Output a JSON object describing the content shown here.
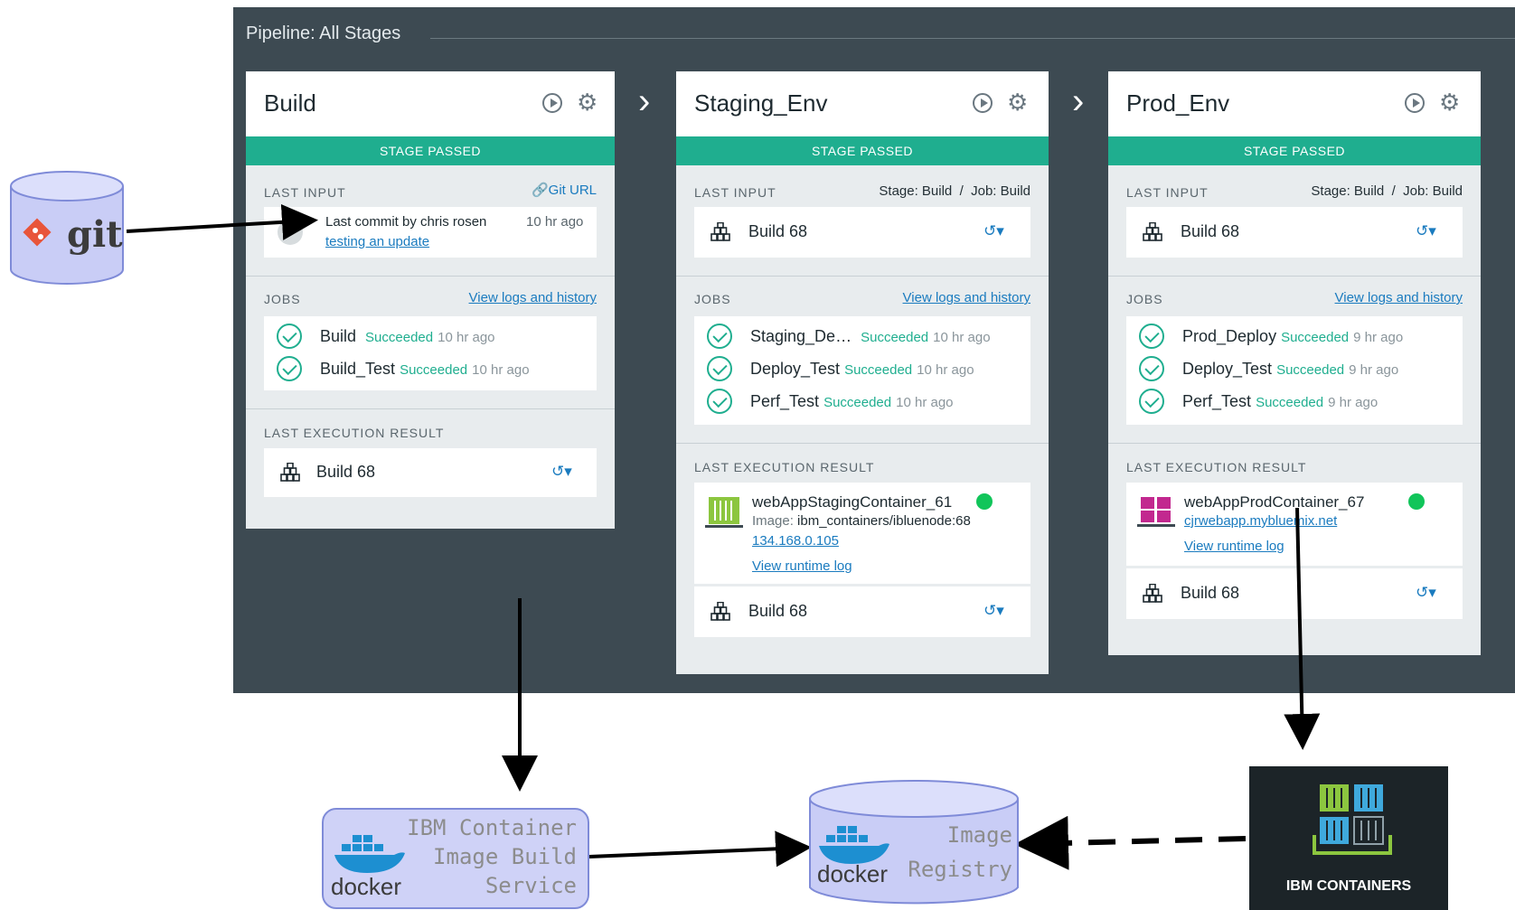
{
  "pipeline": {
    "title": "Pipeline: All Stages"
  },
  "stages": [
    {
      "name": "Build",
      "status": "STAGE PASSED",
      "last_input_label": "LAST INPUT",
      "git_url_label": "Git URL",
      "commit_text": "Last commit by chris rosen",
      "commit_time": "10 hr ago",
      "commit_message": "testing an update",
      "jobs_label": "JOBS",
      "view_logs": "View logs and history",
      "jobs": [
        {
          "name": "Build",
          "status": "Succeeded",
          "time": "10 hr ago"
        },
        {
          "name": "Build_Test",
          "status": "Succeeded",
          "time": "10 hr ago"
        }
      ],
      "last_exec_label": "LAST EXECUTION RESULT",
      "build": "Build 68"
    },
    {
      "name": "Staging_Env",
      "status": "STAGE PASSED",
      "last_input_label": "LAST INPUT",
      "input_source": "Stage: Build  /  Job: Build",
      "input_build": "Build 68",
      "jobs_label": "JOBS",
      "view_logs": "View logs and history",
      "jobs": [
        {
          "name": "Staging_De…",
          "status": "Succeeded",
          "time": "10 hr ago"
        },
        {
          "name": "Deploy_Test",
          "status": "Succeeded",
          "time": "10 hr ago"
        },
        {
          "name": "Perf_Test",
          "status": "Succeeded",
          "time": "10 hr ago"
        }
      ],
      "last_exec_label": "LAST EXECUTION RESULT",
      "container_name": "webAppStagingContainer_61",
      "image_label": "Image:",
      "image_value": "ibm_containers/ibluenode:68",
      "ip": "134.168.0.105",
      "runtime_log": "View runtime log",
      "build": "Build 68"
    },
    {
      "name": "Prod_Env",
      "status": "STAGE PASSED",
      "last_input_label": "LAST INPUT",
      "input_source": "Stage: Build  /  Job: Build",
      "input_build": "Build 68",
      "jobs_label": "JOBS",
      "view_logs": "View logs and history",
      "jobs": [
        {
          "name": "Prod_Deploy",
          "status": "Succeeded",
          "time": "9 hr ago"
        },
        {
          "name": "Deploy_Test",
          "status": "Succeeded",
          "time": "9 hr ago"
        },
        {
          "name": "Perf_Test",
          "status": "Succeeded",
          "time": "9 hr ago"
        }
      ],
      "last_exec_label": "LAST EXECUTION RESULT",
      "container_name": "webAppProdContainer_67",
      "url": "cjrwebapp.mybluemix.net",
      "runtime_log": "View runtime log",
      "build": "Build 68"
    }
  ],
  "diagram": {
    "git_label": "git",
    "build_service_label": [
      "IBM Container",
      "Image Build",
      "Service"
    ],
    "registry_label": [
      "Image",
      "Registry"
    ],
    "docker_label": "docker",
    "ibm_containers_label": "IBM CONTAINERS"
  },
  "colors": {
    "accent": "#1fae8f",
    "link": "#1a7bbf",
    "panel": "#3d4a52"
  }
}
